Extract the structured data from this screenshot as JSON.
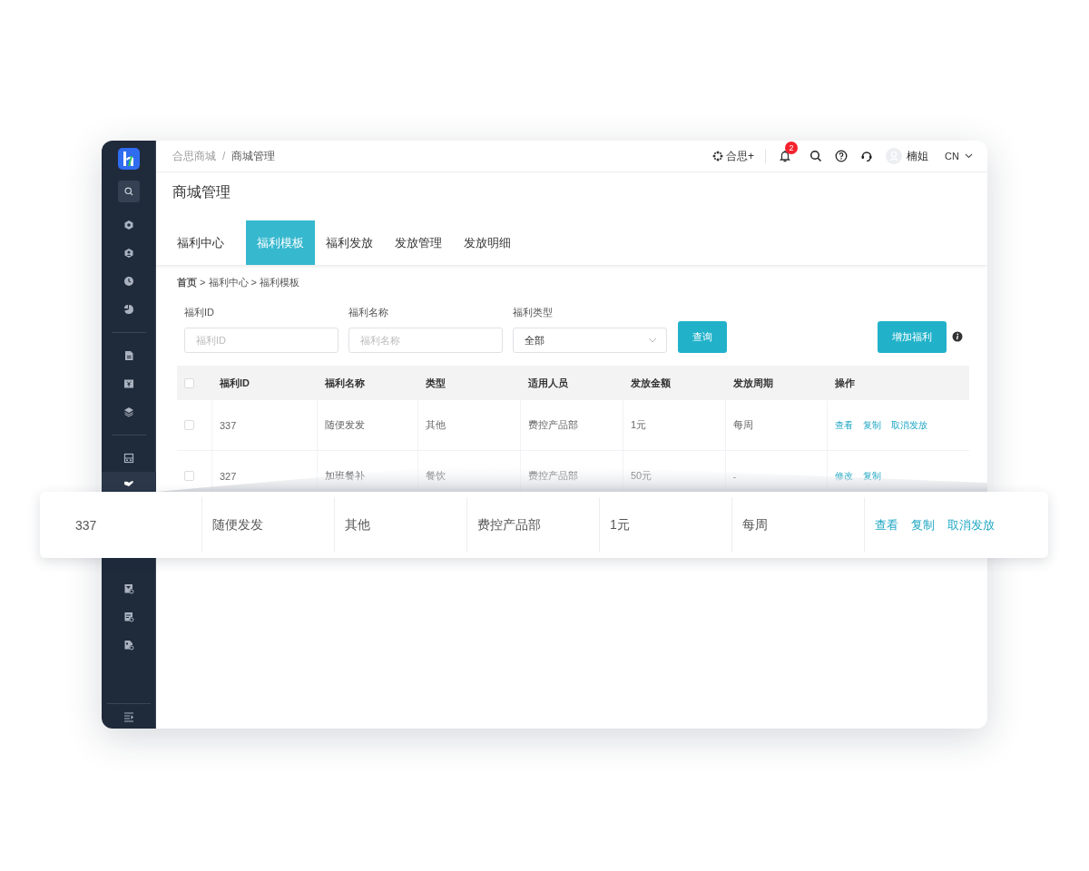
{
  "sidebar": {
    "items": [
      {
        "kind": "icon",
        "selected": false
      },
      {
        "kind": "icon",
        "selected": false
      },
      {
        "kind": "icon",
        "selected": false
      },
      {
        "kind": "icon",
        "selected": false
      },
      {
        "kind": "divider"
      },
      {
        "kind": "icon",
        "selected": false
      },
      {
        "kind": "icon",
        "selected": false
      },
      {
        "kind": "icon",
        "selected": false
      },
      {
        "kind": "divider"
      },
      {
        "kind": "icon",
        "selected": false
      },
      {
        "kind": "icon",
        "selected": true
      }
    ],
    "lower_items": [
      {
        "kind": "icon",
        "selected": false
      },
      {
        "kind": "icon",
        "selected": false
      },
      {
        "kind": "icon",
        "selected": false
      }
    ]
  },
  "header": {
    "breadcrumb": [
      "合思商城",
      "商城管理"
    ],
    "breadcrumb_separator": "/",
    "brand": "合思+",
    "notification_count": "2",
    "user": "楠姐",
    "language": "CN"
  },
  "page_title": "商城管理",
  "tabs": [
    {
      "label": "福利中心",
      "selected": false
    },
    {
      "label": "福利模板",
      "selected": true
    },
    {
      "label": "福利发放",
      "selected": false
    },
    {
      "label": "发放管理",
      "selected": false
    },
    {
      "label": "发放明细",
      "selected": false
    }
  ],
  "path": "**首页** > 福利中心 > 福利模板",
  "filters": [
    {
      "kind": "input",
      "label": "福利ID",
      "placeholder": "福利ID"
    },
    {
      "kind": "input",
      "label": "福利名称",
      "placeholder": "福利名称"
    },
    {
      "kind": "select",
      "label": "福利类型",
      "value": "全部"
    }
  ],
  "query_button": "查询",
  "add_button": "增加福利",
  "table": {
    "all_checked": false,
    "columns": [
      "福利ID",
      "福利名称",
      "类型",
      "适用人员",
      "发放金额",
      "发放周期",
      "操作"
    ],
    "rows": [
      {
        "checked": false,
        "cells": [
          "337",
          "随便发发",
          "其他",
          "费控产品部",
          "1元",
          "每周"
        ],
        "actions": [
          "查看",
          "复制",
          "取消发放"
        ]
      },
      {
        "checked": false,
        "cells": [
          "327",
          "加班餐补",
          "餐饮",
          "费控产品部",
          "50元",
          "-"
        ],
        "actions": [
          "修改",
          "复制"
        ]
      }
    ]
  },
  "highlight_row": {
    "cells": [
      "337",
      "随便发发",
      "其他",
      "费控产品部",
      "1元",
      "每周"
    ],
    "actions": [
      "查看",
      "复制",
      "取消发放"
    ]
  }
}
